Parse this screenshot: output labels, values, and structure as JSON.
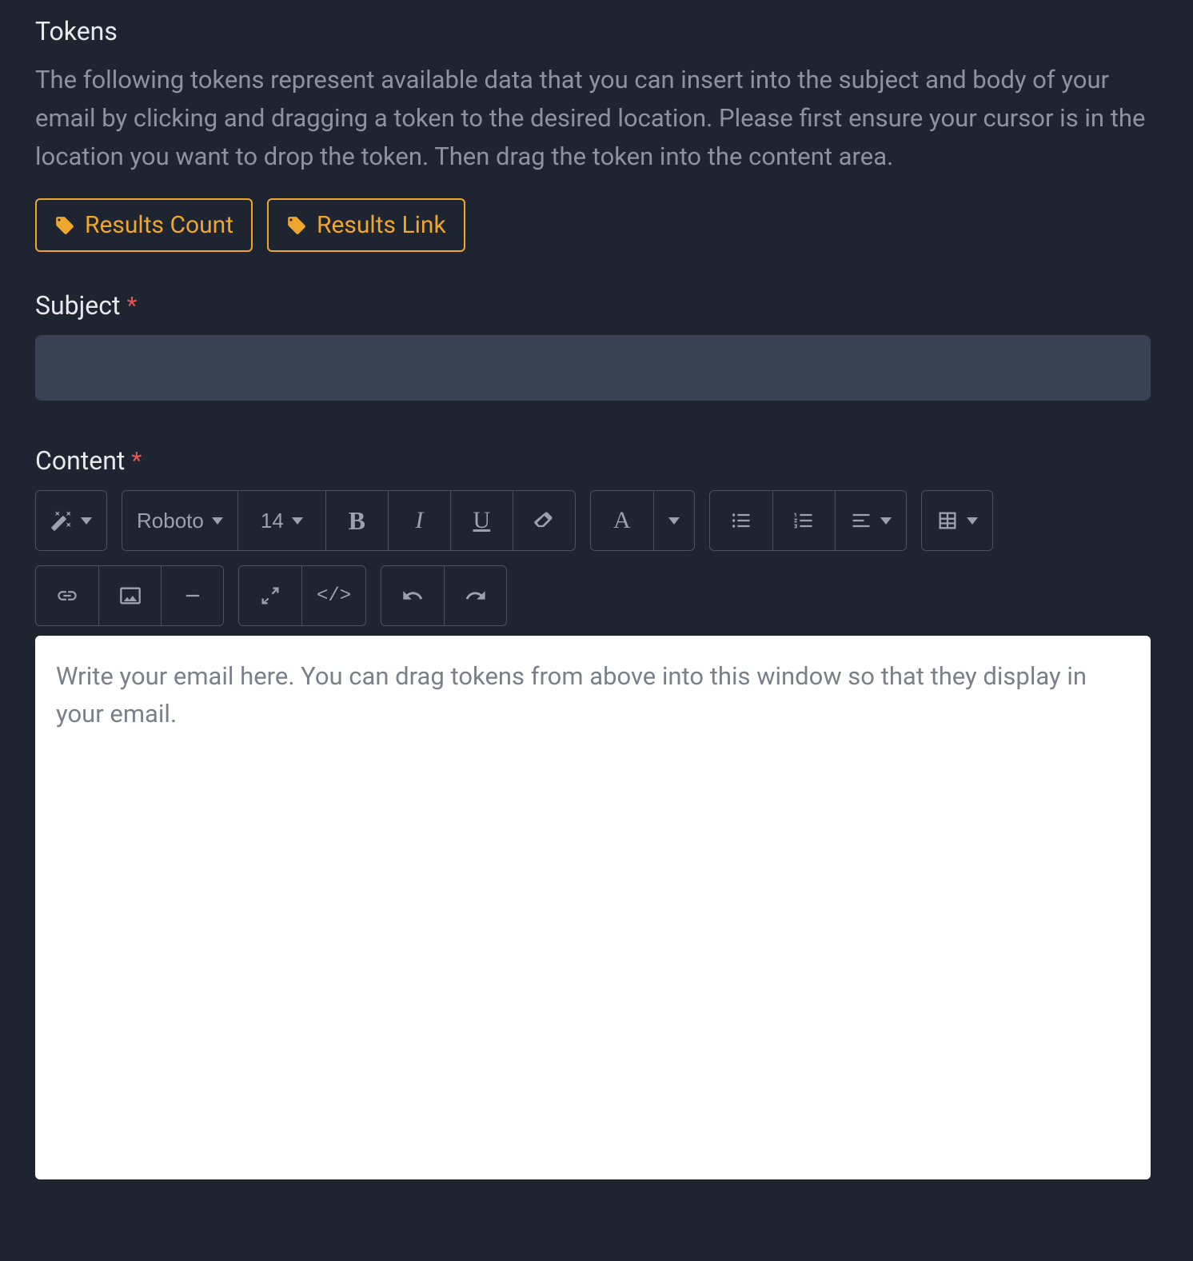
{
  "tokens": {
    "heading": "Tokens",
    "description": "The following tokens represent available data that you can insert into the subject and body of your email by clicking and dragging a token to the desired location. Please first ensure your cursor is in the location you want to drop the token. Then drag the token into the content area.",
    "items": [
      {
        "label": "Results Count"
      },
      {
        "label": "Results Link"
      }
    ]
  },
  "subject": {
    "label": "Subject",
    "required_marker": "*",
    "value": ""
  },
  "content": {
    "label": "Content",
    "required_marker": "*",
    "placeholder": "Write your email here. You can drag tokens from above into this window so that they display in your email."
  },
  "toolbar": {
    "font_family": "Roboto",
    "font_size": "14",
    "bold_label": "B",
    "italic_label": "I",
    "underline_label": "U",
    "font_color_label": "A",
    "code_view_label": "</>"
  }
}
